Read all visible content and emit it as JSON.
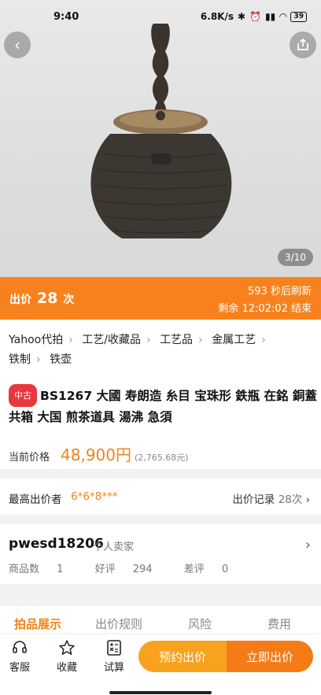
{
  "status_bar": {
    "time": "9:40",
    "speed": "6.8K/s",
    "battery": "39"
  },
  "hero": {
    "counter": "3/10"
  },
  "bid_bar": {
    "label_prefix": "出价",
    "bid_count": "28",
    "label_suffix": "次",
    "refresh_seconds": "593",
    "refresh_text": "秒后刷新",
    "remaining_label": "剩余",
    "remaining_time": "12:02:02",
    "end_label": "结束"
  },
  "breadcrumb": [
    "Yahoo代拍",
    "工艺/收藏品",
    "工艺品",
    "金属工艺",
    "铁制",
    "铁壶"
  ],
  "item": {
    "tag": "中古",
    "title": "BS1267 大國 寿朗造 糸目 宝珠形 鉄瓶 在銘 銅蓋 共箱 大国 煎茶道具 湯沸 急須",
    "price_label": "当前价格",
    "price": "48,900円",
    "price_rmb": "(2,765.68元)"
  },
  "high_bid": {
    "label": "最高出价者",
    "bidder": "6*6*8***",
    "record_label": "出价记录",
    "record_count": "28次"
  },
  "seller": {
    "name": "pwesd18206",
    "type": "个人卖家",
    "items_label": "商品数",
    "items_count": "1",
    "good_label": "好评",
    "good_count": "294",
    "bad_label": "差评",
    "bad_count": "0"
  },
  "tabs": [
    "拍品展示",
    "出价规则",
    "风险",
    "费用"
  ],
  "bottom_bar": {
    "service": "客服",
    "favorite": "收藏",
    "calc": "试算",
    "reserve": "预约出价",
    "buy": "立即出价"
  },
  "colors": {
    "accent": "#f7821d",
    "price": "#f08418",
    "tag": "#e8383d"
  }
}
